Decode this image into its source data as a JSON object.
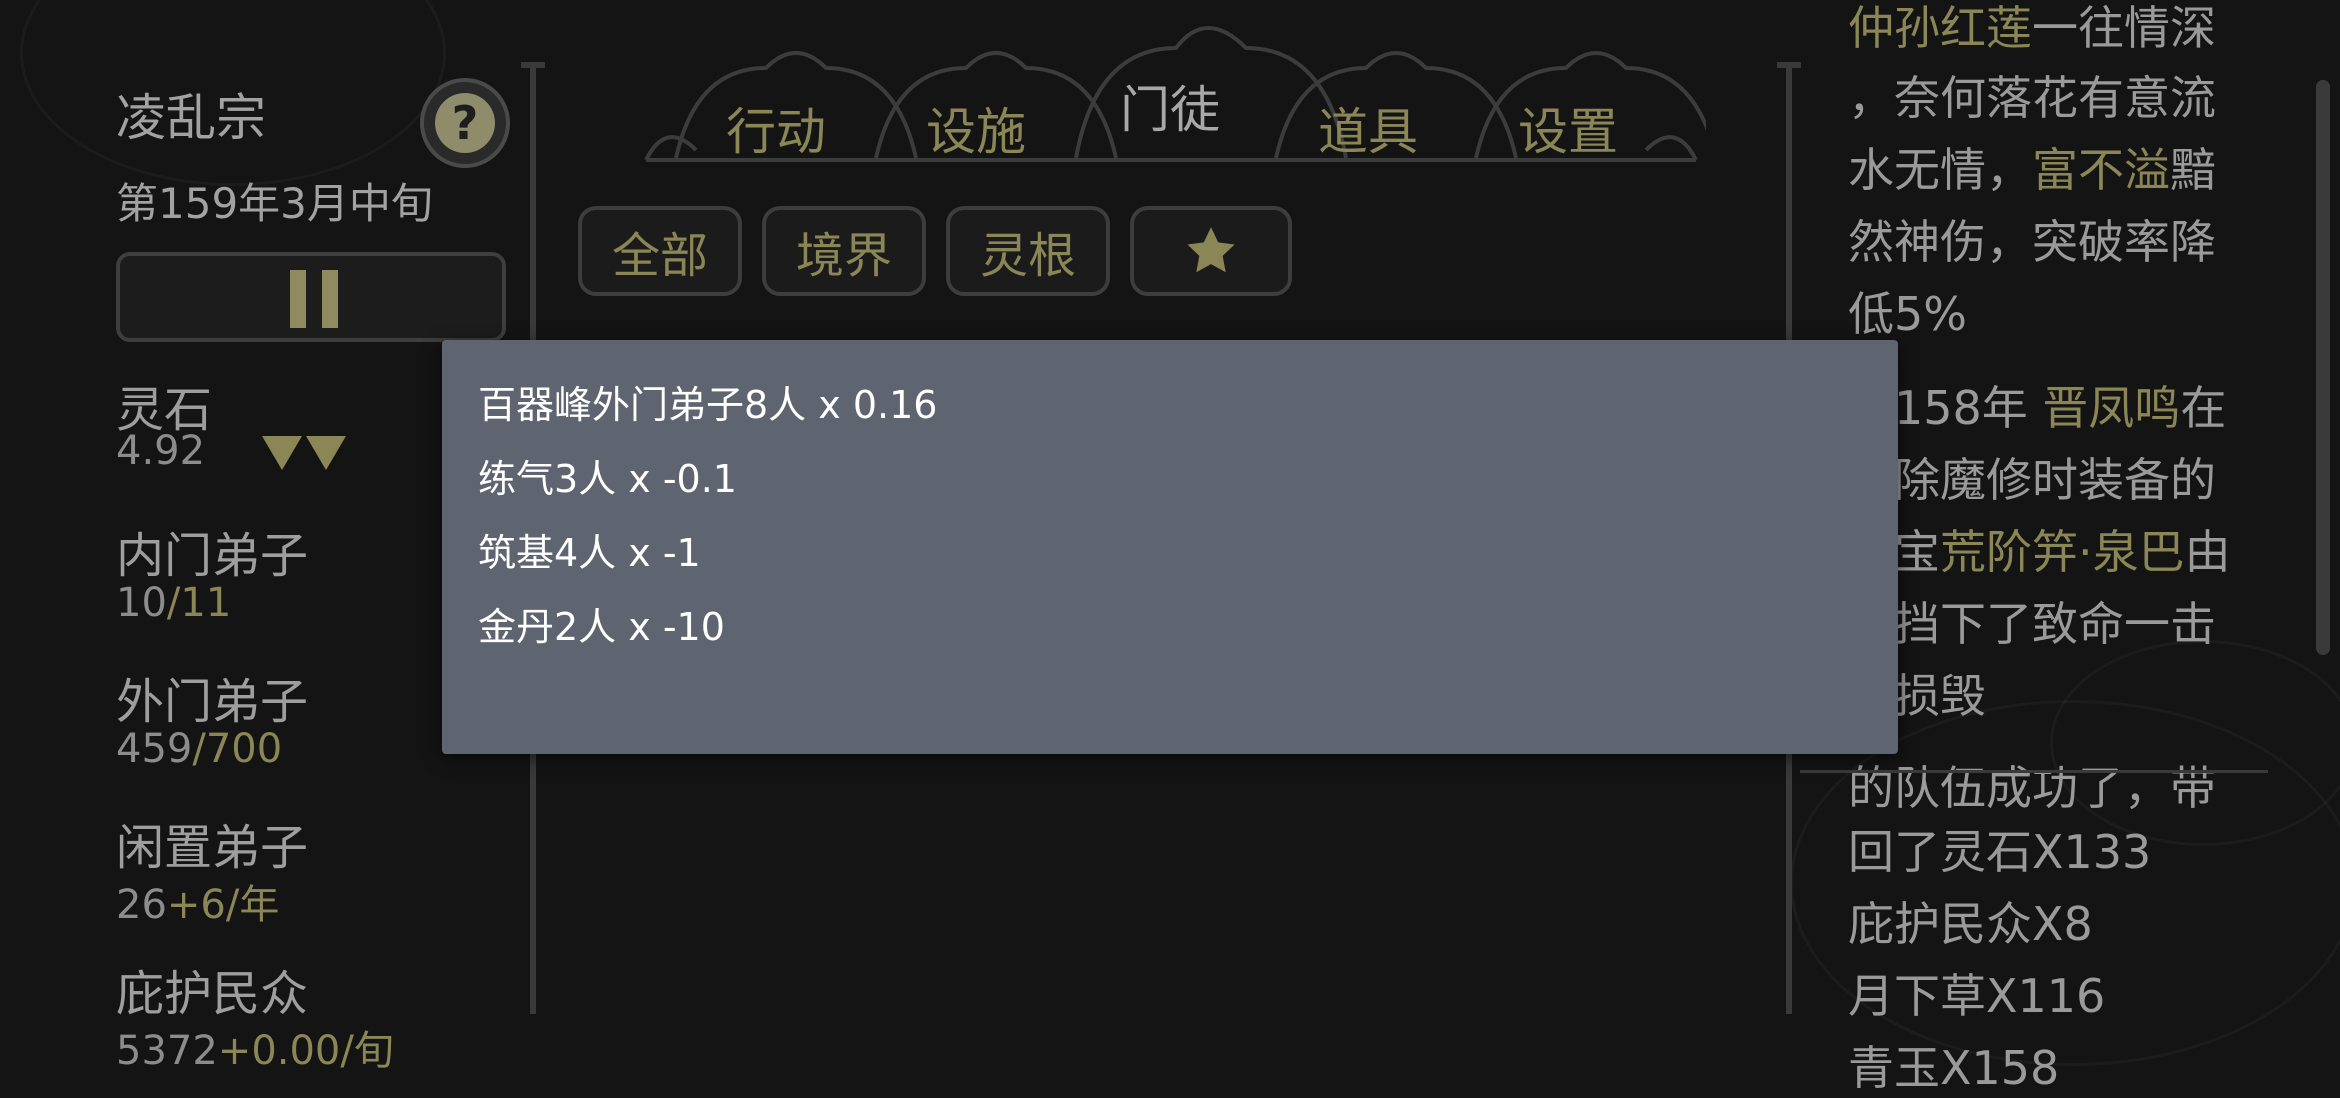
{
  "sidebar": {
    "sect_name": "凌乱宗",
    "help_label": "?",
    "date": "第159年3月中旬",
    "spirit_stone": {
      "label": "灵石",
      "value": "4.92"
    },
    "inner_disciples": {
      "label": "内门弟子",
      "value": "10",
      "max": "/11"
    },
    "outer_disciples": {
      "label": "外门弟子",
      "value": "459",
      "max": "/700"
    },
    "idle_disciples": {
      "label": "闲置弟子",
      "value": "26",
      "rate": "+6/年"
    },
    "protected_people": {
      "label": "庇护民众",
      "value": "5372",
      "rate": "+0.00/旬"
    }
  },
  "tabs": [
    {
      "label": "行动",
      "active": false
    },
    {
      "label": "设施",
      "active": false
    },
    {
      "label": "门徒",
      "active": true
    },
    {
      "label": "道具",
      "active": false
    },
    {
      "label": "设置",
      "active": false
    }
  ],
  "filters": [
    "全部",
    "境界",
    "灵根"
  ],
  "filter_star_icon": "star-icon",
  "log": {
    "l1a": "仲孙红莲",
    "l1b": "一往情深",
    "l2": "，奈何落花有意流",
    "l3": "水无情，",
    "l3b": "富不溢",
    "l3c": "黯",
    "l4": "然神伤，突破率降",
    "l5": "低5%",
    "l6a": "第158年 ",
    "l6b": "晋凤鸣",
    "l6c": "在",
    "l7": "剿除魔修时装备的",
    "l8a": "法宝",
    "l8b": "荒阶笄·泉巴",
    "l8c": "由",
    "l9": "于挡下了致命一击",
    "l10": "而损毁",
    "l11": "的队伍成功了，带",
    "l12": "回了灵石X133",
    "l13": "庇护民众X8",
    "l14": "月下草X116",
    "l15": "青玉X158"
  },
  "popup": {
    "lines": [
      "百器峰外门弟子8人 x 0.16",
      "练气3人 x -0.1",
      "筑基4人 x -1",
      "金丹2人 x -10"
    ]
  },
  "colors": {
    "gold": "#8a8656",
    "popup_bg": "#5e6570",
    "background": "#141414"
  }
}
